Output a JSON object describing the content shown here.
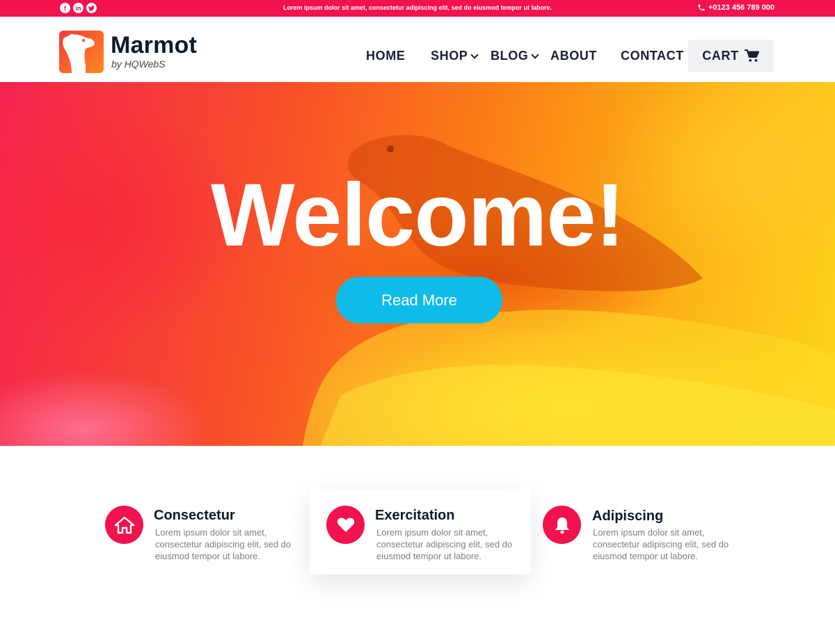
{
  "topbar": {
    "social_icons": [
      "facebook-icon",
      "linkedin-icon",
      "twitter-icon"
    ],
    "message": "Lorem ipsum dolor sit amet, consectetur adipiscing elit, sed do eiusmod tempor ut labore.",
    "phone": "+0123 456 789 000",
    "bg_color": "#f2124e"
  },
  "header": {
    "logo_title": "Marmot",
    "logo_subtitle": "by HQWebS",
    "nav": [
      {
        "label": "HOME"
      },
      {
        "label": "SHOP"
      },
      {
        "label": "BLOG"
      },
      {
        "label": "ABOUT"
      },
      {
        "label": "CONTACT"
      }
    ],
    "cart_label": "CART"
  },
  "hero": {
    "heading": "Welcome!",
    "button_label": "Read More",
    "button_color": "#0fbce9"
  },
  "features": [
    {
      "icon": "home-icon",
      "title": "Consectetur",
      "text": "Lorem ipsum dolor sit amet, consectetur adipiscing elit, sed do eiusmod tempor ut labore."
    },
    {
      "icon": "heart-icon",
      "title": "Exercitation",
      "text": "Lorem ipsum dolor sit amet, consectetur adipiscing elit, sed do eiusmod tempor ut labore."
    },
    {
      "icon": "bell-icon",
      "title": "Adipiscing",
      "text": "Lorem ipsum dolor sit amet, consectetur adipiscing elit, sed do eiusmod tempor ut labore."
    }
  ],
  "colors": {
    "accent": "#f2124e",
    "text_dark": "#0d1b2a"
  }
}
